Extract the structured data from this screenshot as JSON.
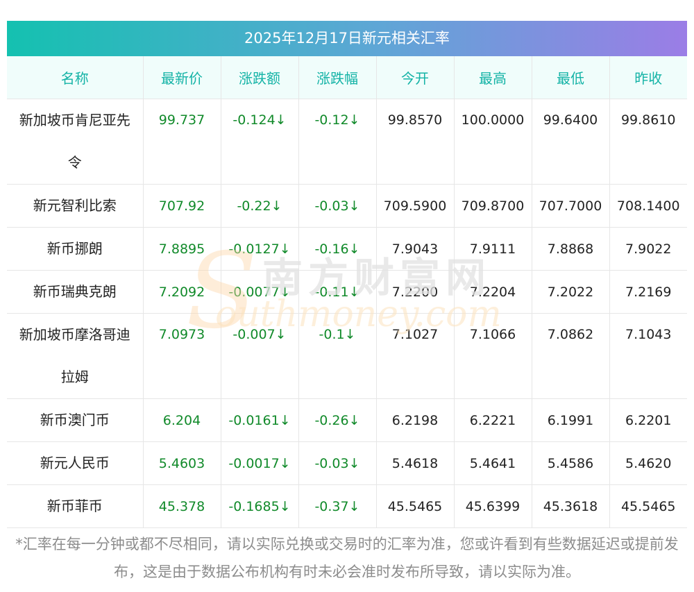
{
  "title": "2025年12月17日新元相关汇率",
  "headers": [
    "名称",
    "最新价",
    "涨跌额",
    "涨跌幅",
    "今开",
    "最高",
    "最低",
    "昨收"
  ],
  "rows": [
    {
      "name_line1": "新加坡币肯尼亚先",
      "name_line2": "令",
      "latest": "99.737",
      "change": "-0.124↓",
      "change_pct": "-0.12↓",
      "open": "99.8570",
      "high": "100.0000",
      "low": "99.6400",
      "prev_close": "99.8610"
    },
    {
      "name_line1": "新元智利比索",
      "name_line2": "",
      "latest": "707.92",
      "change": "-0.22↓",
      "change_pct": "-0.03↓",
      "open": "709.5900",
      "high": "709.8700",
      "low": "707.7000",
      "prev_close": "708.1400"
    },
    {
      "name_line1": "新币挪朗",
      "name_line2": "",
      "latest": "7.8895",
      "change": "-0.0127↓",
      "change_pct": "-0.16↓",
      "open": "7.9043",
      "high": "7.9111",
      "low": "7.8868",
      "prev_close": "7.9022"
    },
    {
      "name_line1": "新币瑞典克朗",
      "name_line2": "",
      "latest": "7.2092",
      "change": "-0.0077↓",
      "change_pct": "-0.11↓",
      "open": "7.2200",
      "high": "7.2204",
      "low": "7.2022",
      "prev_close": "7.2169"
    },
    {
      "name_line1": "新加坡币摩洛哥迪",
      "name_line2": "拉姆",
      "latest": "7.0973",
      "change": "-0.007↓",
      "change_pct": "-0.1↓",
      "open": "7.1027",
      "high": "7.1066",
      "low": "7.0862",
      "prev_close": "7.1043"
    },
    {
      "name_line1": "新币澳门币",
      "name_line2": "",
      "latest": "6.204",
      "change": "-0.0161↓",
      "change_pct": "-0.26↓",
      "open": "6.2198",
      "high": "6.2221",
      "low": "6.1991",
      "prev_close": "6.2201"
    },
    {
      "name_line1": "新元人民币",
      "name_line2": "",
      "latest": "5.4603",
      "change": "-0.0017↓",
      "change_pct": "-0.03↓",
      "open": "5.4618",
      "high": "5.4641",
      "low": "5.4586",
      "prev_close": "5.4620"
    },
    {
      "name_line1": "新币菲币",
      "name_line2": "",
      "latest": "45.378",
      "change": "-0.1685↓",
      "change_pct": "-0.37↓",
      "open": "45.5465",
      "high": "45.6399",
      "low": "45.3618",
      "prev_close": "45.5465"
    }
  ],
  "watermark": {
    "cn": "南方财富网",
    "en": "outhmoney.com",
    "s": "S"
  },
  "footer": "*汇率在每一分钟或都不尽相同，请以实际兑换或交易时的汇率为准，您或许看到有些数据延迟或提前发布，这是由于数据公布机构有时未必会准时发布所导致，请以实际为准。",
  "colors": {
    "header_text": "#14b3a6",
    "header_bg": "#f0fdfb",
    "down": "#118a2a",
    "title_grad_start": "#14c1b0",
    "title_grad_end": "#9b7de6"
  }
}
